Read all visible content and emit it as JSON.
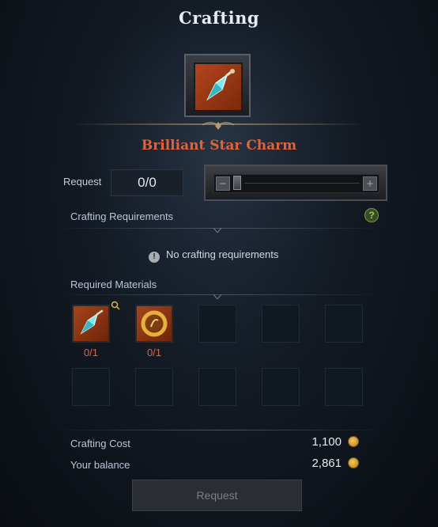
{
  "window": {
    "title": "Crafting"
  },
  "item": {
    "name": "Brilliant Star Charm",
    "icon": "crystal-charm-icon"
  },
  "request": {
    "label": "Request",
    "count": "0/0"
  },
  "slider": {
    "minus": "−",
    "plus": "+"
  },
  "requirements": {
    "heading": "Crafting Requirements",
    "help": "?",
    "info_glyph": "!",
    "empty_text": "No crafting requirements"
  },
  "materials": {
    "heading": "Required Materials",
    "items": [
      {
        "icon": "crystal-charm-icon",
        "count": "0/1"
      },
      {
        "icon": "golden-ring-icon",
        "count": "0/1"
      }
    ]
  },
  "cost": {
    "label": "Crafting Cost",
    "value": "1,100",
    "balance_label": "Your balance",
    "balance_value": "2,861",
    "currency_icon": "gold-coin-icon"
  },
  "footer": {
    "request_button": "Request"
  },
  "colors": {
    "item_name": "#e0633a",
    "accent_gold": "#8d7a52",
    "help_green": "#8ed04a"
  }
}
